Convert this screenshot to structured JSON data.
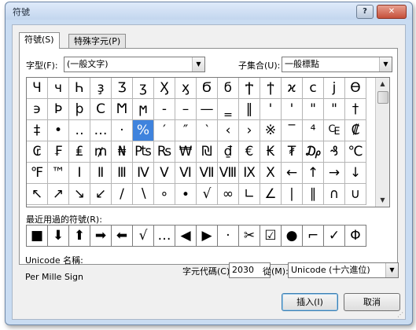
{
  "dialog": {
    "title": "符號",
    "help_glyph": "?",
    "close_glyph": "✕"
  },
  "tabs": [
    {
      "label": "符號(S)",
      "active": true
    },
    {
      "label": "特殊字元(P)",
      "active": false
    }
  ],
  "font": {
    "label": "字型(F):",
    "value": "(一般文字)"
  },
  "subset": {
    "label": "子集合(U):",
    "value": "一般標點"
  },
  "symbols": [
    "Ч",
    "ч",
    "Һ",
    "ҙ",
    "Ӡ",
    "ӡ",
    "Ӽ",
    "ӽ",
    "Ϭ",
    "ϭ",
    "Ϯ",
    "ϯ",
    "ϰ",
    "ϲ",
    "ϳ",
    "ϴ",
    "϶",
    "Ϸ",
    "ϸ",
    "Ϲ",
    "Ϻ",
    "ϻ",
    "‐",
    "–",
    "—",
    "‗",
    "‖",
    "'",
    "'",
    "\"",
    "\"",
    "†",
    "‡",
    "•",
    "‥",
    "…",
    "‧",
    "%",
    "′",
    "″",
    "‵",
    "‹",
    "›",
    "※",
    "‾",
    "⁄",
    "₠",
    "₡",
    "₢",
    "₣",
    "₤",
    "₥",
    "₦",
    "₧",
    "₨",
    "₩",
    "₪",
    "₫",
    "€",
    "₭",
    "₮",
    "₯",
    "₰",
    "℃",
    "℉",
    "™",
    "Ⅰ",
    "Ⅱ",
    "Ⅲ",
    "Ⅳ",
    "Ⅴ",
    "Ⅵ",
    "Ⅶ",
    "Ⅷ",
    "Ⅸ",
    "Ⅹ",
    "←",
    "↑",
    "→",
    "↓",
    "↖",
    "↗",
    "↘",
    "↙",
    "∕",
    "∖",
    "∘",
    "∙",
    "√",
    "∞",
    "∟",
    "∠",
    "∣",
    "∥",
    "∩",
    "∪",
    "∫",
    "∮",
    "∴"
  ],
  "symbols_fix": {
    "row1": [
      "Ч",
      "ч",
      "Һ",
      "ҙ",
      "Ӡ",
      "ӡ",
      "Ӽ",
      "ӽ",
      "Ϭ",
      "ϭ",
      "Ϯ",
      "ϯ",
      "ϰ",
      "ϲ",
      "ϳ",
      "ϴ"
    ],
    "row2": [
      "϶",
      "Ϸ",
      "ϸ",
      "Ϲ",
      "Ϻ",
      "ϻ",
      "‐",
      "–",
      "—",
      "‗",
      "‖",
      "'",
      "'",
      "\"",
      "\"",
      "†"
    ],
    "row3": [
      "‡",
      "•",
      "‥",
      "…",
      "‧",
      "%",
      "′",
      "″",
      "‵",
      "‹",
      "›",
      "※",
      "‾",
      "⁴",
      "₠",
      "₡"
    ],
    "row4": [
      "₢",
      "₣",
      "₤",
      "₥",
      "₦",
      "₧",
      "₨",
      "₩",
      "₪",
      "₫",
      "€",
      "₭",
      "₮",
      "₯",
      "₰",
      "℃"
    ],
    "row5": [
      "℉",
      "™",
      "Ⅰ",
      "Ⅱ",
      "Ⅲ",
      "Ⅳ",
      "Ⅴ",
      "Ⅵ",
      "Ⅶ",
      "Ⅷ",
      "Ⅸ",
      "Ⅹ",
      "←",
      "↑",
      "→",
      "↓"
    ],
    "row6": [
      "↖",
      "↗",
      "↘",
      "↙",
      "∕",
      "∖",
      "∘",
      "∙",
      "√",
      "∞",
      "∟",
      "∠",
      "∣",
      "∥",
      "∩",
      "∪"
    ]
  },
  "recent": {
    "label": "最近用過的符號(R):",
    "items": [
      "■",
      "⬇",
      "⬆",
      "➡",
      "⬅",
      "√",
      "…",
      "◀",
      "▶",
      "·",
      "✂",
      "☑",
      "●",
      "⌐",
      "✓",
      "Φ",
      "①",
      "▯"
    ]
  },
  "unicode_name": {
    "label": "Unicode 名稱:",
    "value": "Per Mille Sign"
  },
  "char_code": {
    "label": "字元代碼(C):",
    "value": "2030"
  },
  "from": {
    "label": "從(M):",
    "value": "Unicode (十六進位)"
  },
  "buttons": {
    "insert": "插入(I)",
    "cancel": "取消"
  }
}
